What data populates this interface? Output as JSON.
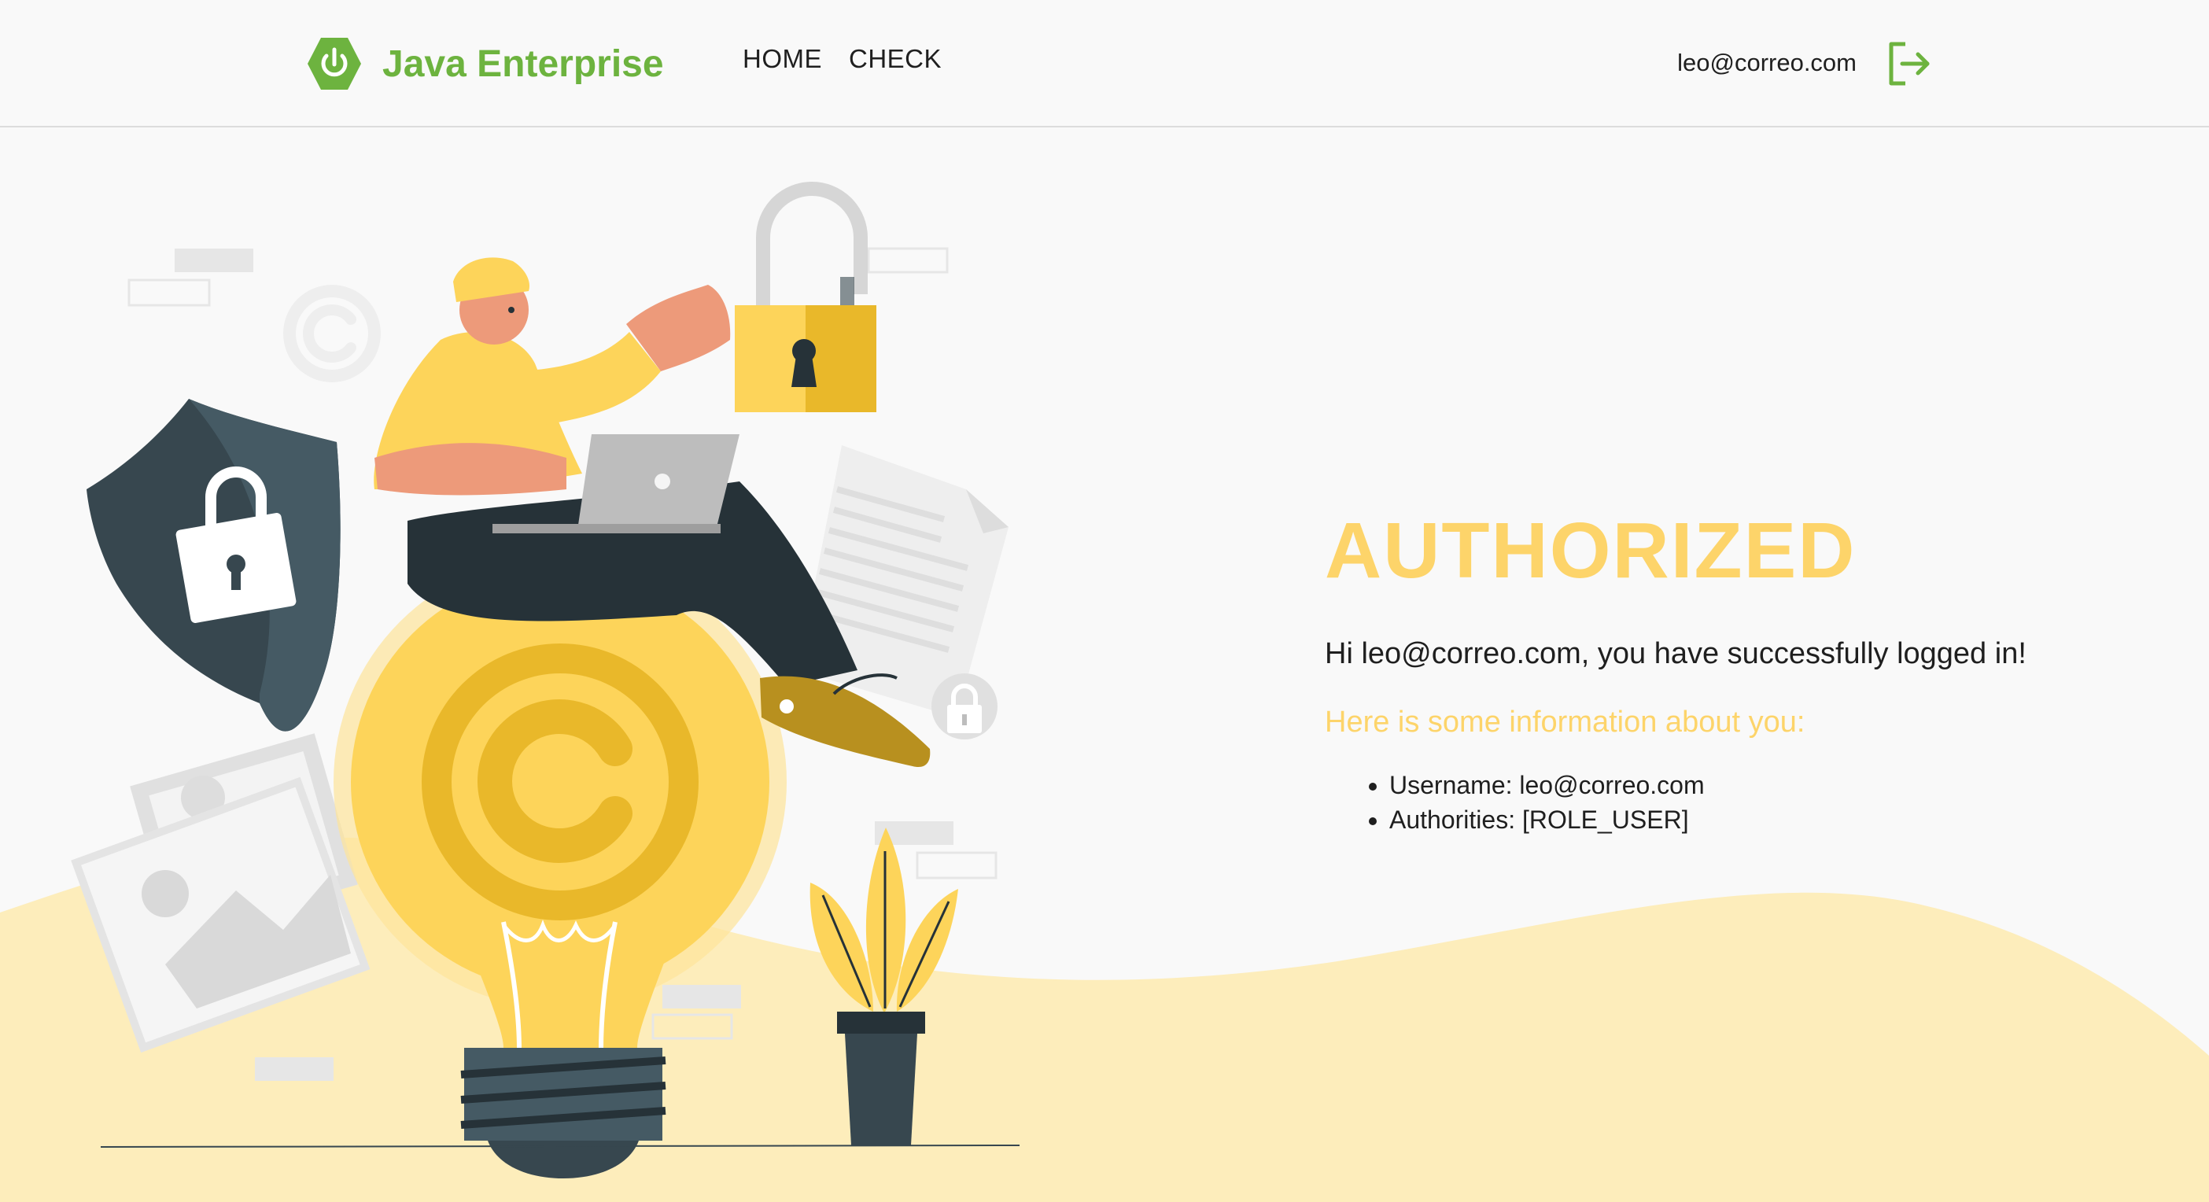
{
  "header": {
    "brand": "Java Enterprise",
    "nav": [
      {
        "label": "HOME"
      },
      {
        "label": "CHECK"
      }
    ],
    "user_email": "leo@correo.com",
    "logout_icon": "logout-icon"
  },
  "main": {
    "title": "AUTHORIZED",
    "greeting": "Hi leo@correo.com, you have successfully logged in!",
    "info_heading": "Here is some information about you:",
    "info_items": [
      {
        "text": "Username: leo@correo.com"
      },
      {
        "text": "Authorities: [ROLE_USER]"
      }
    ]
  },
  "colors": {
    "brand_green": "#6db33f",
    "accent_yellow": "#fdd46a",
    "wave_yellow": "#fdedbb",
    "background": "#f9f9f9"
  }
}
